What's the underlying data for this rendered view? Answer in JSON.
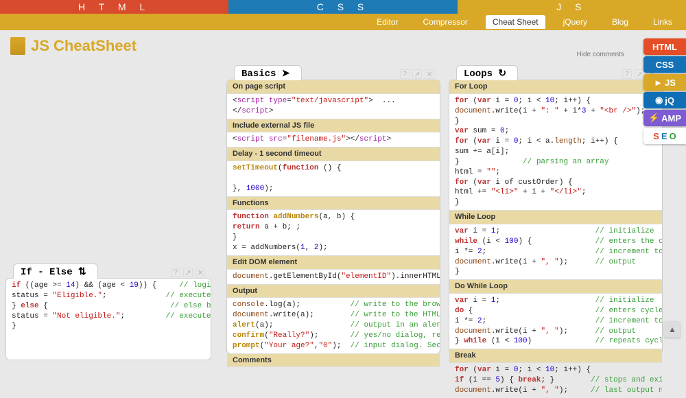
{
  "top_tabs": {
    "html": "H T M L",
    "css": "C S S",
    "js": "J S"
  },
  "sub_nav": {
    "editor": "Editor",
    "compressor": "Compressor",
    "cheatsheet": "Cheat Sheet",
    "jquery": "jQuery",
    "blog": "Blog",
    "links": "Links"
  },
  "page_title": "JS CheatSheet",
  "hide_comments": "Hide comments",
  "side_badges": {
    "html": "HTML",
    "css": "CSS",
    "js": "JS",
    "jq": "jQ",
    "amp": "AMP",
    "seo_s": "S",
    "seo_e": "E",
    "seo_o": "O"
  },
  "cards": {
    "ifelse": {
      "title": "If - Else ⇅",
      "code": "if ((age >= 14) && (age < 19)) {     // logical condit\nstatus = \"Eligible.\";             // executed if condi\n} else {                           // else block is a\nstatus = \"Not eligible.\";         // executed if condit\n}"
    },
    "basics": {
      "title": "Basics ➤",
      "sections": {
        "onpage_h": "On page script",
        "onpage_c": "<script type=\"text/javascript\">  ...\n</scr ipt>",
        "include_h": "Include external JS file",
        "include_c": "<script src=\"filename.js\"></scri pt>",
        "delay_h": "Delay - 1 second timeout",
        "delay_c": "setTimeout(function () {\n\n}, 1000);",
        "func_h": "Functions",
        "func_c": "function addNumbers(a, b) {\nreturn a + b; ;\n}\nx = addNumbers(1, 2);",
        "dom_h": "Edit DOM element",
        "dom_c": "document.getElementById(\"elementID\").innerHTML = \"Hello W",
        "output_h": "Output",
        "output_c": "console.log(a);           // write to the browser cons\ndocument.write(a);        // write to the HTML\nalert(a);                 // output in an alert box\nconfirm(\"Really?\");       // yes/no dialog, returns tru\nprompt(\"Your age?\",\"0\");  // input dialog. Second argum",
        "comments_h": "Comments"
      }
    },
    "loops": {
      "title": "Loops ↻",
      "sections": {
        "for_h": "For Loop",
        "for_c": "for (var i = 0; i < 10; i++) {\ndocument.write(i + \": \" + i*3 + \"<br />\");\n}\nvar sum = 0;\nfor (var i = 0; i < a.length; i++) {\nsum += a[i];\n}              // parsing an array\nhtml = \"\";\nfor (var i of custOrder) {\nhtml += \"<li>\" + i + \"</li>\";\n}",
        "while_h": "While Loop",
        "while_c": "var i = 1;                     // initialize\nwhile (i < 100) {              // enters the cycle if st\ni *= 2;                        // increment to avoid infini\ndocument.write(i + \", \");      // output\n}",
        "dowhile_h": "Do While Loop",
        "dowhile_c": "var i = 1;                     // initialize\ndo {                           // enters cycle at least\ni *= 2;                        // increment to avoid infini\ndocument.write(i + \", \");      // output\n} while (i < 100)              // repeats cycle if state",
        "break_h": "Break",
        "break_c": "for (var i = 0; i < 10; i++) {\nif (i == 5) { break; }        // stops and exits the\ndocument.write(i + \", \");     // last output number is"
      }
    }
  }
}
